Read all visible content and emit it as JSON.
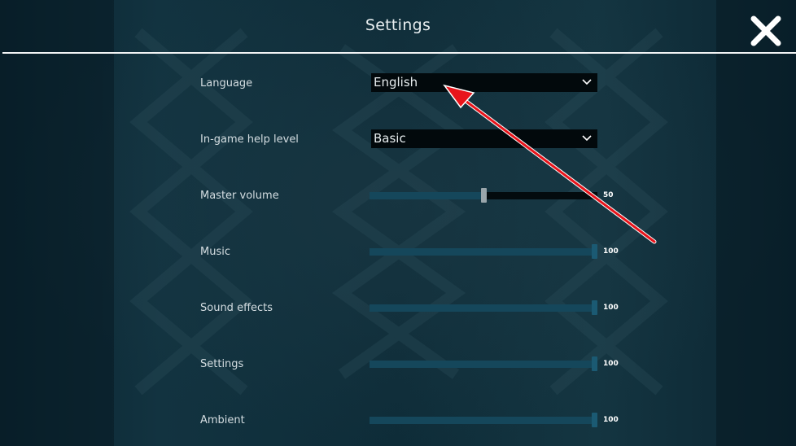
{
  "window": {
    "title": "Settings",
    "close_icon": "close-x-icon"
  },
  "settings": {
    "language": {
      "label": "Language",
      "value": "English"
    },
    "help_level": {
      "label": "In-game help level",
      "value": "Basic"
    },
    "sliders": [
      {
        "label": "Master volume",
        "value": "50",
        "level": 50
      },
      {
        "label": "Music",
        "value": "100",
        "level": 100
      },
      {
        "label": "Sound effects",
        "value": "100",
        "level": 100
      },
      {
        "label": "Settings",
        "value": "100",
        "level": 100
      },
      {
        "label": "Ambient",
        "value": "100",
        "level": 100
      }
    ]
  },
  "annotation": {
    "arrow_color": "#e8141b"
  },
  "colors": {
    "background": "#0d2a35",
    "slider_fill": "#15475b",
    "select_bg": "#02090c"
  }
}
